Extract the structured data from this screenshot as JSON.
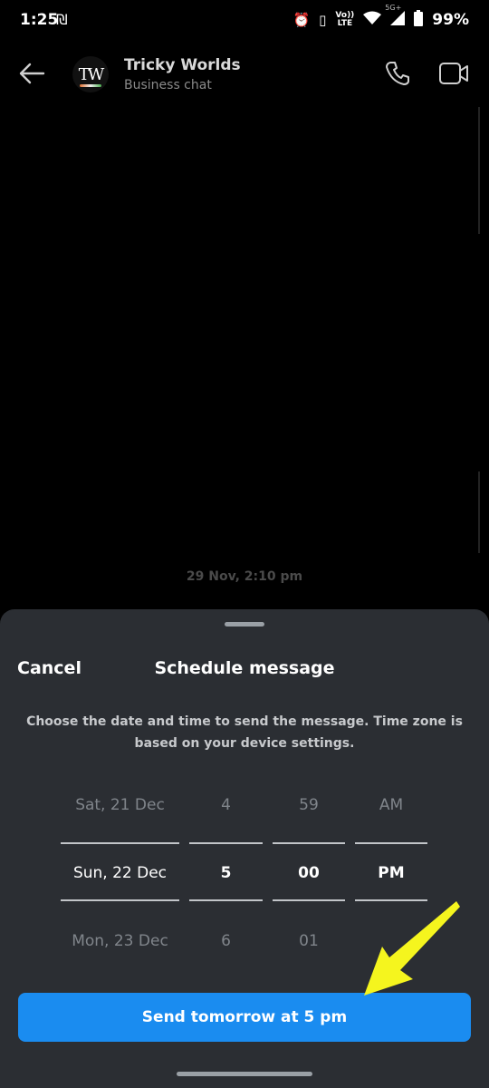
{
  "status_bar": {
    "time": "1:25",
    "lte_top": "Vo))",
    "lte_bottom": "LTE",
    "network": "5G+",
    "battery": "99%"
  },
  "header": {
    "avatar_initials": "TW",
    "name": "Tricky Worlds",
    "subtitle": "Business chat"
  },
  "chat": {
    "date_stamp": "29 Nov, 2:10 pm"
  },
  "sheet": {
    "cancel_label": "Cancel",
    "title": "Schedule message",
    "description": "Choose the date and time to send the message. Time zone is based on your device settings.",
    "picker": {
      "date": {
        "prev": "Sat, 21 Dec",
        "selected": "Sun, 22 Dec",
        "next": "Mon, 23 Dec"
      },
      "hour": {
        "prev": "4",
        "selected": "5",
        "next": "6"
      },
      "minute": {
        "prev": "59",
        "selected": "00",
        "next": "01"
      },
      "period": {
        "prev": "AM",
        "selected": "PM",
        "next": ""
      }
    },
    "send_label": "Send tomorrow at 5 pm"
  },
  "colors": {
    "accent": "#1a8cf0",
    "sheet_bg": "#2b2e33",
    "arrow": "#f5f51e"
  }
}
